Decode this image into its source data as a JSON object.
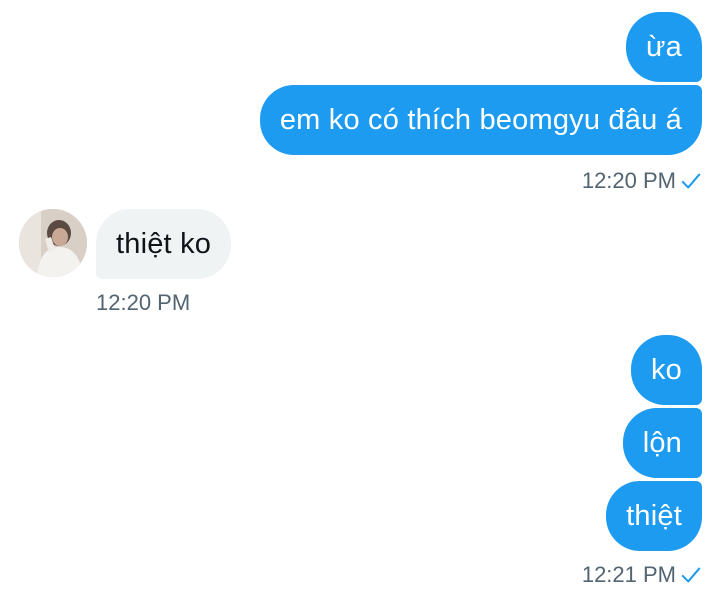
{
  "messages": {
    "group1": {
      "bubbles": [
        "ừa",
        "em ko có thích beomgyu đâu á"
      ],
      "time": "12:20 PM"
    },
    "group2": {
      "bubbles": [
        "thiệt ko"
      ],
      "time": "12:20 PM"
    },
    "group3": {
      "bubbles": [
        "ko",
        "lộn",
        "thiệt"
      ],
      "time": "12:21 PM"
    }
  },
  "colors": {
    "outgoing_bubble": "#1d9bf0",
    "incoming_bubble": "#eff3f4",
    "timestamp": "#536471",
    "read_check": "#1d9bf0"
  },
  "icons": {
    "read_receipt": "check-icon",
    "contact_avatar": "avatar"
  }
}
